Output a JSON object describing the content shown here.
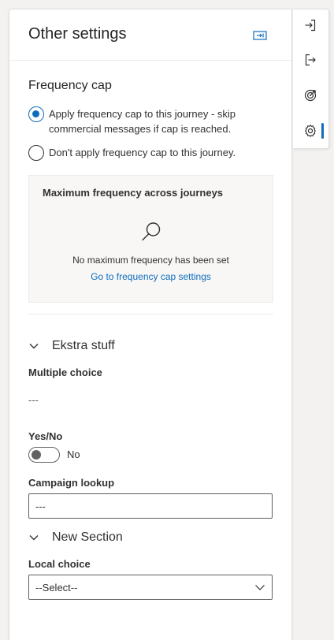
{
  "panel": {
    "title": "Other settings",
    "collapse_icon": "collapse-panel-icon"
  },
  "frequency_cap": {
    "section_title": "Frequency cap",
    "options": [
      {
        "label": "Apply frequency cap to this journey - skip commercial messages if cap is reached.",
        "selected": true
      },
      {
        "label": "Don't apply frequency cap to this journey.",
        "selected": false
      }
    ],
    "box": {
      "title": "Maximum frequency across journeys",
      "icon": "search-icon",
      "empty_text": "No maximum frequency has been set",
      "link_text": "Go to frequency cap settings"
    }
  },
  "ekstra": {
    "section_title": "Ekstra stuff",
    "multiple_choice": {
      "label": "Multiple choice",
      "value": "---"
    },
    "yes_no": {
      "label": "Yes/No",
      "value_text": "No",
      "on": false
    },
    "campaign_lookup": {
      "label": "Campaign lookup",
      "value": "---"
    }
  },
  "new_section": {
    "section_title": "New Section",
    "local_choice": {
      "label": "Local choice",
      "selected": "--Select--"
    }
  },
  "rail": {
    "items": [
      {
        "icon": "sign-in-icon",
        "active": false
      },
      {
        "icon": "sign-out-icon",
        "active": false
      },
      {
        "icon": "target-icon",
        "active": false
      },
      {
        "icon": "settings-gear-icon",
        "active": true
      }
    ]
  },
  "colors": {
    "accent": "#0f6cbd",
    "text": "#323130",
    "border": "#e1dfdd"
  }
}
